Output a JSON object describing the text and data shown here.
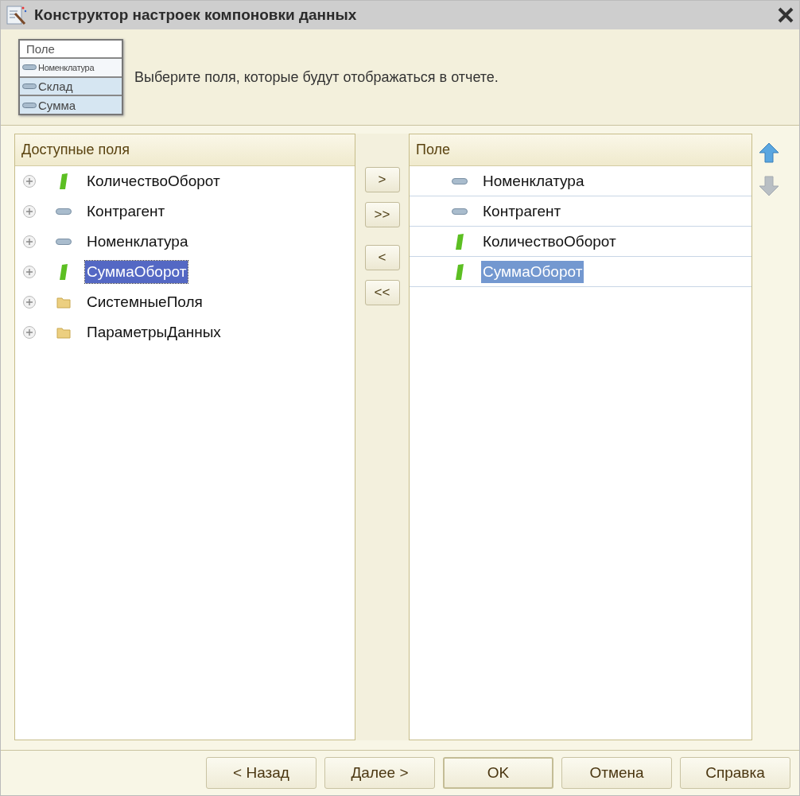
{
  "window": {
    "title": "Конструктор настроек компоновки данных"
  },
  "header": {
    "illustration": {
      "heading": "Поле",
      "rows": [
        "Номенклатура",
        "Склад",
        "Сумма"
      ]
    },
    "text": "Выберите поля, которые будут отображаться в отчете."
  },
  "available_fields": {
    "heading": "Доступные поля",
    "items": [
      {
        "label": "КоличествоОборот",
        "kind": "resource",
        "selected": false
      },
      {
        "label": "Контрагент",
        "kind": "dimension",
        "selected": false
      },
      {
        "label": "Номенклатура",
        "kind": "dimension",
        "selected": false
      },
      {
        "label": "СуммаОборот",
        "kind": "resource",
        "selected": true
      },
      {
        "label": "СистемныеПоля",
        "kind": "folder",
        "selected": false
      },
      {
        "label": "ПараметрыДанных",
        "kind": "folder",
        "selected": false
      }
    ]
  },
  "transfer_buttons": [
    ">",
    ">>",
    "<",
    "<<"
  ],
  "selected_fields": {
    "heading": "Поле",
    "items": [
      {
        "label": "Номенклатура",
        "kind": "dimension",
        "selected": false
      },
      {
        "label": "Контрагент",
        "kind": "dimension",
        "selected": false
      },
      {
        "label": "КоличествоОборот",
        "kind": "resource",
        "selected": false
      },
      {
        "label": "СуммаОборот",
        "kind": "resource",
        "selected": true
      }
    ]
  },
  "move_buttons": [
    {
      "kind": "up",
      "disabled": false
    },
    {
      "kind": "down",
      "disabled": true
    }
  ],
  "footer_buttons": [
    {
      "label": "< Назад",
      "default": false
    },
    {
      "label": "Далее >",
      "default": false
    },
    {
      "label": "OK",
      "default": true
    },
    {
      "label": "Отмена",
      "default": false
    },
    {
      "label": "Справка",
      "default": false
    }
  ]
}
